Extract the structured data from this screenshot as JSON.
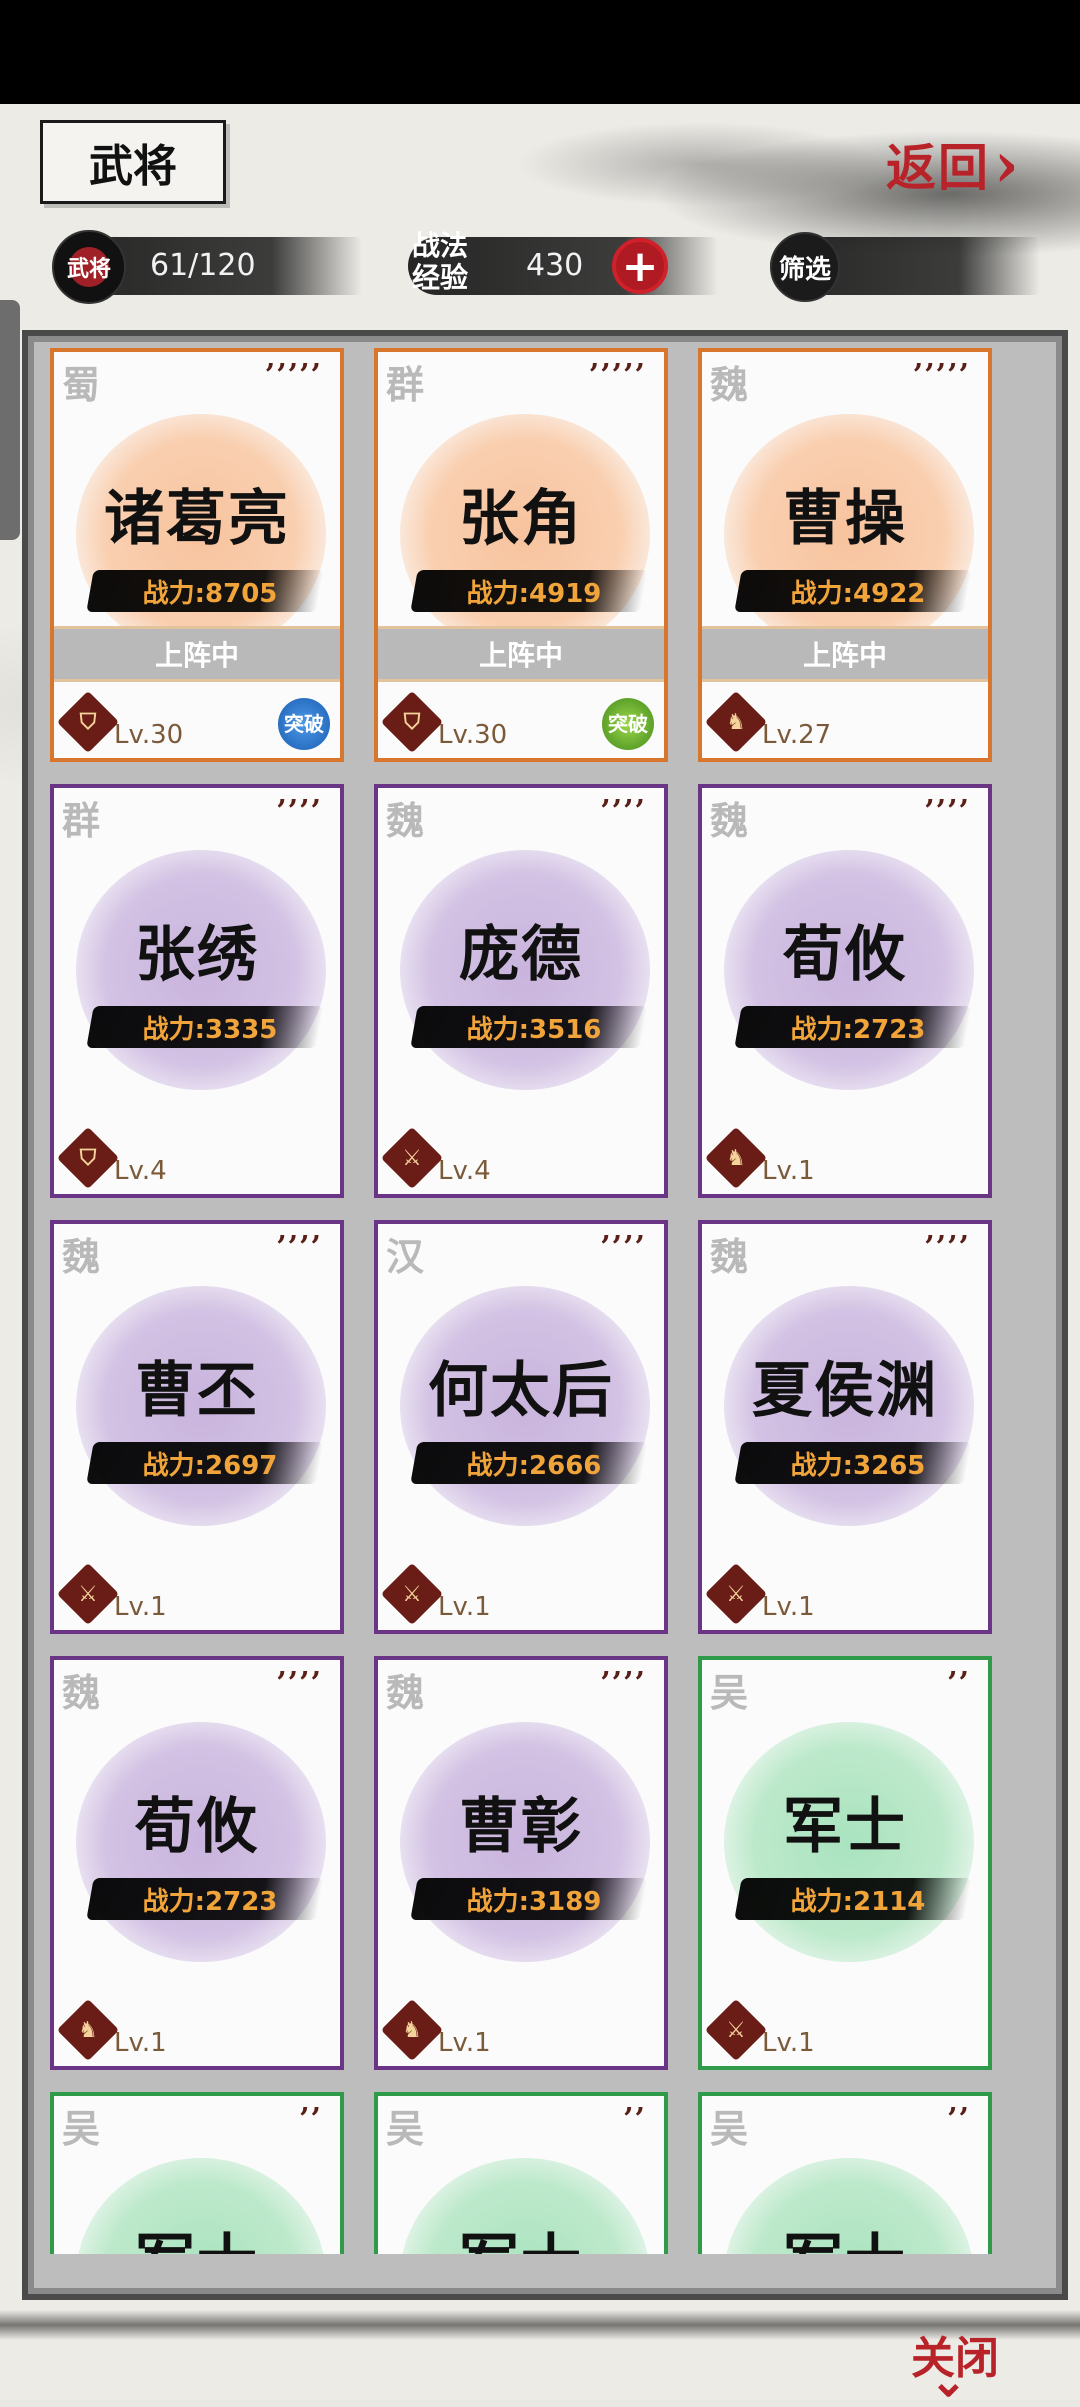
{
  "header": {
    "title": "武将",
    "back_label": "返回"
  },
  "stats": {
    "generals_icon": "武将",
    "generals_count": "61/120",
    "tactics_label_1": "战法",
    "tactics_label_2": "经验",
    "tactics_exp": "430",
    "filter_label": "筛选"
  },
  "cards": [
    {
      "faction": "蜀",
      "stars": "’’’’’",
      "name": "诸葛亮",
      "power": "战力:8705",
      "deployed": "上阵中",
      "level": "Lv.30",
      "role": "shield-icon",
      "breakthrough": "突破",
      "breakthrough_color": "blue",
      "rarity": "orange"
    },
    {
      "faction": "群",
      "stars": "’’’’’",
      "name": "张角",
      "power": "战力:4919",
      "deployed": "上阵中",
      "level": "Lv.30",
      "role": "shield-icon",
      "breakthrough": "突破",
      "breakthrough_color": "green",
      "rarity": "orange"
    },
    {
      "faction": "魏",
      "stars": "’’’’’",
      "name": "曹操",
      "power": "战力:4922",
      "deployed": "上阵中",
      "level": "Lv.27",
      "role": "horse-icon",
      "breakthrough": "",
      "rarity": "orange"
    },
    {
      "faction": "群",
      "stars": "’’’’",
      "name": "张绣",
      "power": "战力:3335",
      "deployed": "",
      "level": "Lv.4",
      "role": "shield-icon",
      "breakthrough": "",
      "rarity": "purple"
    },
    {
      "faction": "魏",
      "stars": "’’’’",
      "name": "庞德",
      "power": "战力:3516",
      "deployed": "",
      "level": "Lv.4",
      "role": "bow-icon",
      "breakthrough": "",
      "rarity": "purple"
    },
    {
      "faction": "魏",
      "stars": "’’’’",
      "name": "荀攸",
      "power": "战力:2723",
      "deployed": "",
      "level": "Lv.1",
      "role": "horse-icon",
      "breakthrough": "",
      "rarity": "purple"
    },
    {
      "faction": "魏",
      "stars": "’’’’",
      "name": "曹丕",
      "power": "战力:2697",
      "deployed": "",
      "level": "Lv.1",
      "role": "bow-icon",
      "breakthrough": "",
      "rarity": "purple"
    },
    {
      "faction": "汉",
      "stars": "’’’’",
      "name": "何太后",
      "power": "战力:2666",
      "deployed": "",
      "level": "Lv.1",
      "role": "bow-icon",
      "breakthrough": "",
      "rarity": "purple"
    },
    {
      "faction": "魏",
      "stars": "’’’’",
      "name": "夏侯渊",
      "power": "战力:3265",
      "deployed": "",
      "level": "Lv.1",
      "role": "bow-icon",
      "breakthrough": "",
      "rarity": "purple"
    },
    {
      "faction": "魏",
      "stars": "’’’’",
      "name": "荀攸",
      "power": "战力:2723",
      "deployed": "",
      "level": "Lv.1",
      "role": "horse-icon",
      "breakthrough": "",
      "rarity": "purple"
    },
    {
      "faction": "魏",
      "stars": "’’’’",
      "name": "曹彰",
      "power": "战力:3189",
      "deployed": "",
      "level": "Lv.1",
      "role": "horse-icon",
      "breakthrough": "",
      "rarity": "purple"
    },
    {
      "faction": "吴",
      "stars": "’’",
      "name": "军士",
      "power": "战力:2114",
      "deployed": "",
      "level": "Lv.1",
      "role": "bow-icon",
      "breakthrough": "",
      "rarity": "green"
    },
    {
      "faction": "吴",
      "stars": "’’",
      "name": "军士",
      "power": "",
      "deployed": "",
      "level": "",
      "role": "",
      "breakthrough": "",
      "rarity": "green"
    },
    {
      "faction": "吴",
      "stars": "’’",
      "name": "军士",
      "power": "",
      "deployed": "",
      "level": "",
      "role": "",
      "breakthrough": "",
      "rarity": "green"
    },
    {
      "faction": "吴",
      "stars": "’’",
      "name": "军士",
      "power": "",
      "deployed": "",
      "level": "",
      "role": "",
      "breakthrough": "",
      "rarity": "green"
    }
  ],
  "footer": {
    "close_label": "关闭"
  }
}
